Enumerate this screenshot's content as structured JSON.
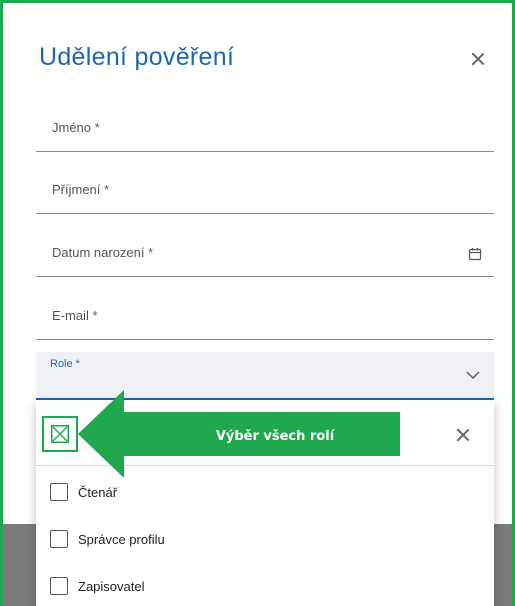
{
  "dialog": {
    "title": "Udělení pověření",
    "fields": {
      "first_name": "Jméno *",
      "last_name": "Příjmení *",
      "birth_date": "Datum narození *",
      "email": "E-mail *",
      "role": "Role *"
    }
  },
  "dropdown": {
    "options": [
      "Čtenář",
      "Správce profilu",
      "Zapisovatel"
    ]
  },
  "callout": {
    "text": "Výběr všech rolí"
  },
  "colors": {
    "accent_blue": "#1f66b0",
    "annotation_green": "#1fa84d",
    "role_field_bg": "#eef1f5"
  },
  "icons": {
    "close": "close-icon",
    "calendar": "calendar-icon",
    "dropdown": "chevron-down-icon",
    "select_all": "select-all-checkbox-icon"
  }
}
